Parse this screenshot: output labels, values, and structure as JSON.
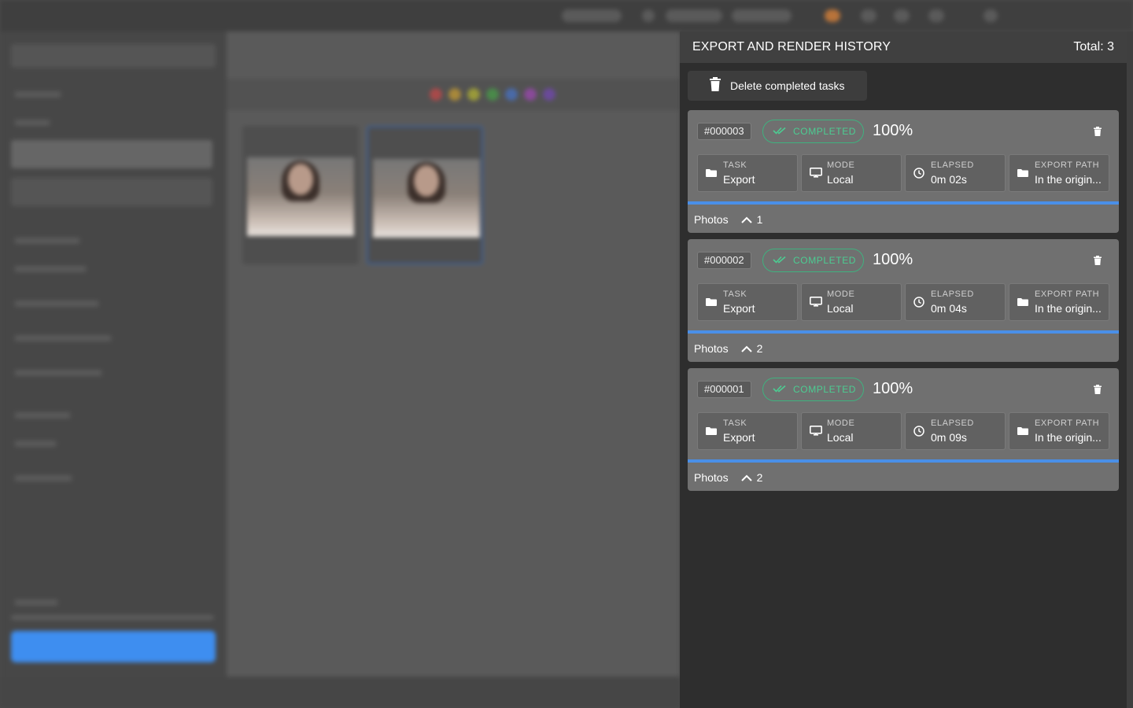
{
  "panel": {
    "title": "EXPORT AND RENDER HISTORY",
    "total": "Total: 3",
    "delete_completed_label": "Delete completed tasks"
  },
  "tasks": [
    {
      "id": "#000003",
      "status": "COMPLETED",
      "percent": "100%",
      "progress": 1.0,
      "task_key": "TASK",
      "task_value": "Export",
      "mode_key": "MODE",
      "mode_value": "Local",
      "elapsed_key": "ELAPSED",
      "elapsed_value": "0m 02s",
      "path_key": "EXPORT PATH",
      "path_value": "In the origin...",
      "photos_label": "Photos",
      "photos_count": "1"
    },
    {
      "id": "#000002",
      "status": "COMPLETED",
      "percent": "100%",
      "progress": 1.0,
      "task_key": "TASK",
      "task_value": "Export",
      "mode_key": "MODE",
      "mode_value": "Local",
      "elapsed_key": "ELAPSED",
      "elapsed_value": "0m 04s",
      "path_key": "EXPORT PATH",
      "path_value": "In the origin...",
      "photos_label": "Photos",
      "photos_count": "2"
    },
    {
      "id": "#000001",
      "status": "COMPLETED",
      "percent": "100%",
      "progress": 1.0,
      "task_key": "TASK",
      "task_value": "Export",
      "mode_key": "MODE",
      "mode_value": "Local",
      "elapsed_key": "ELAPSED",
      "elapsed_value": "0m 09s",
      "path_key": "EXPORT PATH",
      "path_value": "In the origin...",
      "photos_label": "Photos",
      "photos_count": "2"
    }
  ],
  "colors": {
    "accent_blue": "#4a8fe8",
    "status_green": "#4ccc92",
    "panel_bg": "#2e2e2e",
    "card_bg": "#707070"
  },
  "icons": {
    "delete_all": "trash-icon",
    "status": "double-check-icon",
    "task": "folder-icon",
    "mode": "monitor-icon",
    "elapsed": "clock-icon",
    "path": "folder-icon",
    "expand": "chevron-up-icon"
  }
}
